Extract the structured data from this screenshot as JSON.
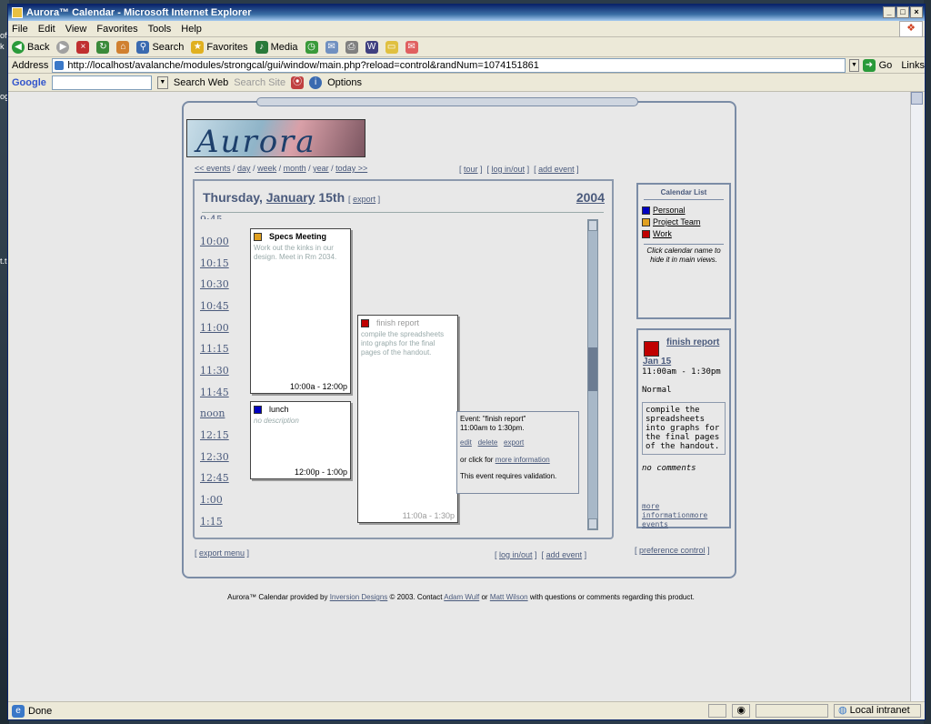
{
  "desktop": {
    "frag1": "oft",
    "frag2": "k",
    "frag3": "t.t",
    "frag4": "ogs"
  },
  "window": {
    "title": "Aurora™ Calendar - Microsoft Internet Explorer",
    "controls": [
      "_",
      "□",
      "×"
    ]
  },
  "menubar": {
    "items": [
      "File",
      "Edit",
      "View",
      "Favorites",
      "Tools",
      "Help"
    ]
  },
  "toolbar": {
    "back": "Back",
    "search": "Search",
    "favorites": "Favorites",
    "media": "Media"
  },
  "address": {
    "label": "Address",
    "url": "http://localhost/avalanche/modules/strongcal/gui/window/main.php?reload=control&randNum=1074151861",
    "go": "Go",
    "links": "Links"
  },
  "googlebar": {
    "logo": "Google",
    "search_web": "Search Web",
    "search_site": "Search Site",
    "options": "Options"
  },
  "calendar": {
    "nav": {
      "events": "<< events",
      "day": "day",
      "week": "week",
      "month": "month",
      "year": "year",
      "today": "today >>"
    },
    "toplinks": {
      "tour": "tour",
      "login": "log in/out",
      "add": "add event"
    },
    "day_title": {
      "weekday": "Thursday,",
      "month": "January",
      "day": "15th",
      "export": "export",
      "year": "2004"
    },
    "times": [
      "9:45",
      "10:00",
      "10:15",
      "10:30",
      "10:45",
      "11:00",
      "11:15",
      "11:30",
      "11:45",
      "noon",
      "12:15",
      "12:30",
      "12:45",
      "1:00",
      "1:15"
    ],
    "events": [
      {
        "title": "Specs Meeting",
        "desc": "Work out the kinks in our design. Meet in Rm 2034.",
        "time": "10:00a - 12:00p",
        "color": "#e0a020"
      },
      {
        "title": "lunch",
        "desc": "no description",
        "time": "12:00p - 1:00p",
        "color": "#0000c0"
      },
      {
        "title": "finish report",
        "desc": "compile the spreadsheets into graphs for the final pages of the handout.",
        "time": "11:00a - 1:30p",
        "color": "#c00000"
      }
    ],
    "popup": {
      "line1": "Event: \"finish report\"",
      "line2": "11:00am to 1:30pm.",
      "edit": "edit",
      "delete": "delete",
      "export": "export",
      "or_click": "or click for",
      "more_info": "more information",
      "validation": "This event requires validation."
    },
    "bottom": {
      "export_menu": "export menu",
      "login": "log in/out",
      "add": "add event",
      "pref": "preference control"
    },
    "calendar_list": {
      "title": "Calendar List",
      "items": [
        {
          "label": "Personal",
          "color": "#0000c0"
        },
        {
          "label": "Project Team",
          "color": "#e0a020"
        },
        {
          "label": "Work",
          "color": "#c00000"
        }
      ],
      "hint": "Click calendar name to hide it in main views."
    },
    "detail": {
      "title": "finish report",
      "date": "Jan 15",
      "time": "11:00am - 1:30pm",
      "priority": "Normal",
      "desc": "compile the spreadsheets into graphs for the final pages of the handout.",
      "comments": "no comments",
      "more_info": "more informationmore events"
    },
    "footer": {
      "text1": "Aurora™ Calendar provided by",
      "link1": "Inversion Designs",
      "text2": "© 2003. Contact",
      "link2": "Adam Wulf",
      "text3": "or",
      "link3": "Matt Wilson",
      "text4": "with questions or comments regarding this product."
    }
  },
  "status": {
    "done": "Done",
    "zone": "Local intranet"
  }
}
